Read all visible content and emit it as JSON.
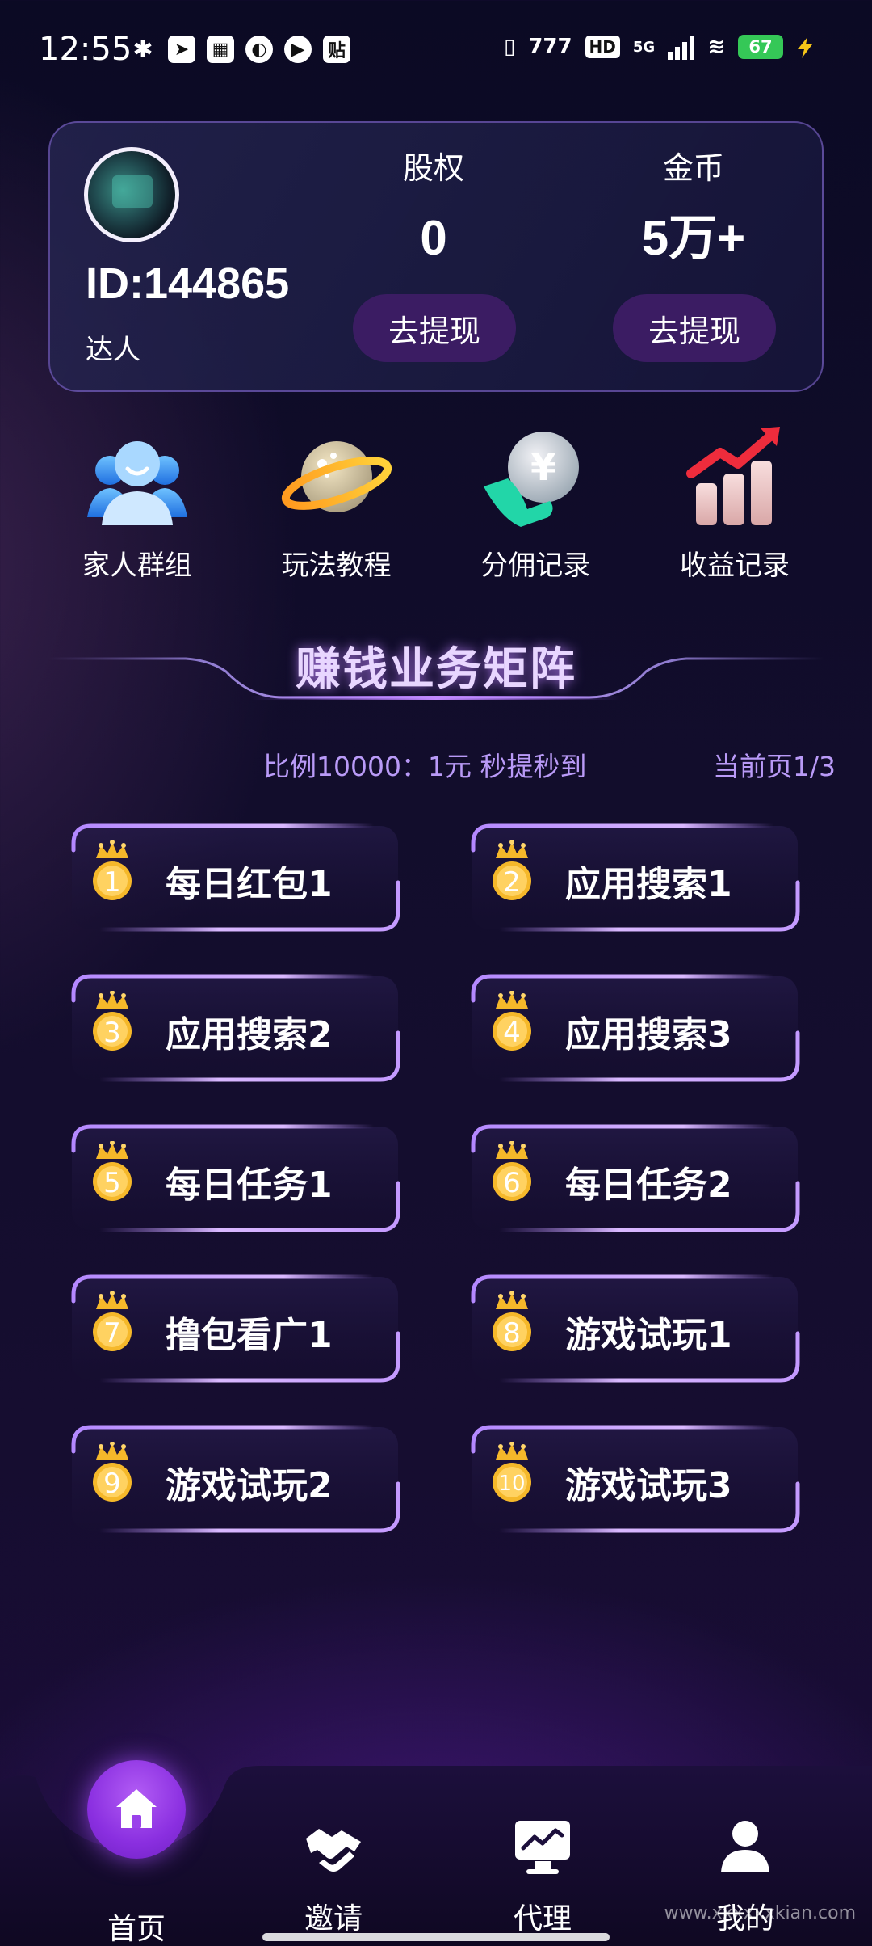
{
  "status_bar": {
    "time": "12:55",
    "left_icons": [
      "figure-icon",
      "send-icon",
      "qr-app-icon",
      "swirl-icon",
      "play-icon",
      "paste-icon"
    ],
    "paste_glyph": "贴",
    "network_label": "777",
    "hd_label": "HD",
    "network_type": "5G",
    "battery": "67"
  },
  "profile": {
    "user_id": "ID:144865",
    "level": "达人",
    "equity_label": "股权",
    "equity_value": "0",
    "coin_label": "金币",
    "coin_value": "5万+",
    "withdraw_label": "去提现"
  },
  "quick_menu": [
    {
      "label": "家人群组",
      "icon": "family-group-icon"
    },
    {
      "label": "玩法教程",
      "icon": "planet-icon"
    },
    {
      "label": "分佣记录",
      "icon": "yuan-hand-icon"
    },
    {
      "label": "收益记录",
      "icon": "bar-chart-icon"
    }
  ],
  "section": {
    "title": "赚钱业务矩阵",
    "ratio_text": "比例10000：1元  秒提秒到",
    "page_text": "当前页1/3"
  },
  "tasks": [
    {
      "rank": "1",
      "label": "每日红包1"
    },
    {
      "rank": "2",
      "label": "应用搜索1"
    },
    {
      "rank": "3",
      "label": "应用搜索2"
    },
    {
      "rank": "4",
      "label": "应用搜索3"
    },
    {
      "rank": "5",
      "label": "每日任务1"
    },
    {
      "rank": "6",
      "label": "每日任务2"
    },
    {
      "rank": "7",
      "label": "撸包看广1"
    },
    {
      "rank": "8",
      "label": "游戏试玩1"
    },
    {
      "rank": "9",
      "label": "游戏试玩2"
    },
    {
      "rank": "10",
      "label": "游戏试玩3"
    }
  ],
  "bottom_nav": [
    {
      "label": "首页",
      "icon": "home-icon",
      "active": true
    },
    {
      "label": "邀请",
      "icon": "handshake-icon"
    },
    {
      "label": "代理",
      "icon": "monitor-chart-icon"
    },
    {
      "label": "我的",
      "icon": "user-icon"
    }
  ],
  "watermark": "www.xxxxxxkian.com",
  "colors": {
    "accent_purple": "#8a2fe0",
    "button_bg": "#3b1c63",
    "info_text": "#b99af7",
    "gold": "#f5b82a"
  }
}
